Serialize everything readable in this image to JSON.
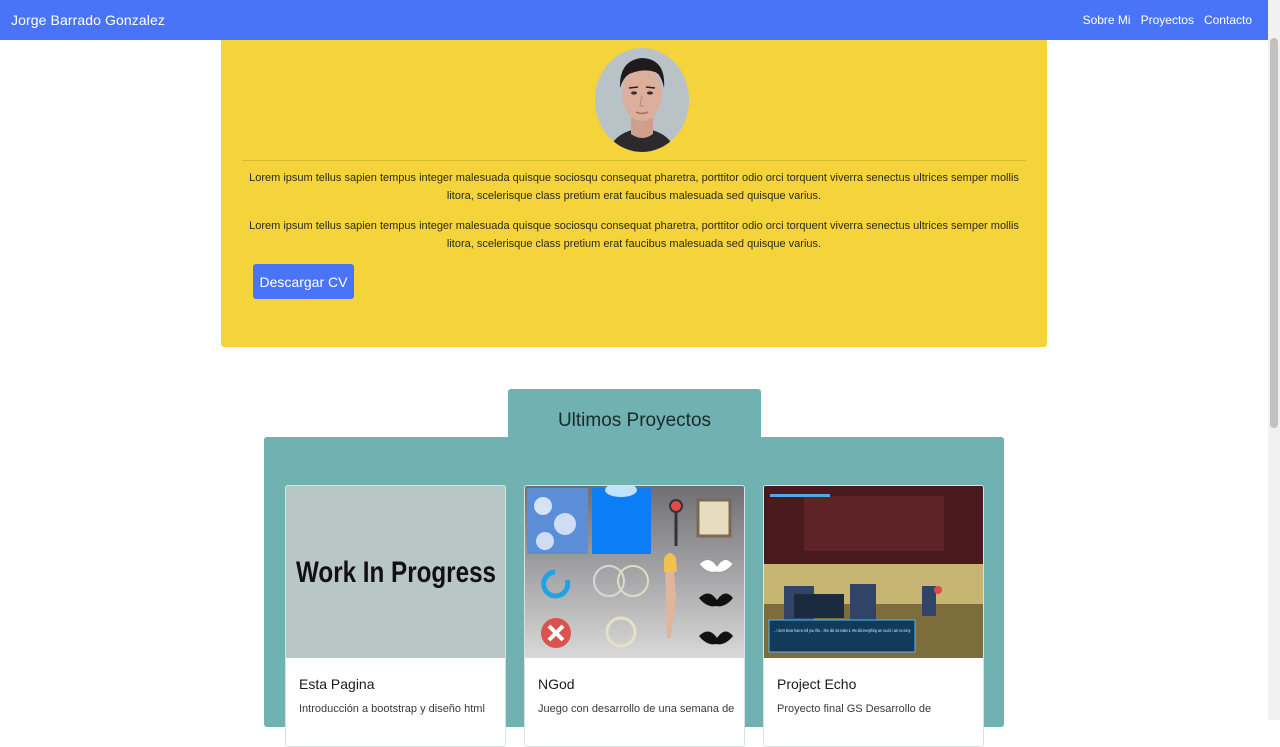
{
  "navbar": {
    "brand": "Jorge Barrado Gonzalez",
    "links": [
      "Sobre Mi",
      "Proyectos",
      "Contacto"
    ],
    "bg_color": "#4a74f7"
  },
  "hero": {
    "bg_color": "#f5d43b",
    "paragraph1": "Lorem ipsum tellus sapien tempus integer malesuada quisque sociosqu consequat pharetra, porttitor odio orci torquent viverra senectus ultrices semper mollis litora, scelerisque class pretium erat faucibus malesuada sed quisque varius.",
    "paragraph2": "Lorem ipsum tellus sapien tempus integer malesuada quisque sociosqu consequat pharetra, porttitor odio orci torquent viverra senectus ultrices semper mollis litora, scelerisque class pretium erat faucibus malesuada sed quisque varius.",
    "cv_button": "Descargar CV"
  },
  "projects": {
    "heading": "Ultimos Proyectos",
    "panel_color": "#6fb2b1",
    "cards": [
      {
        "title": "Esta Pagina",
        "text": "Introducción a bootstrap y diseño html",
        "image_text": "Work In Progress"
      },
      {
        "title": "NGod",
        "text": "Juego con desarrollo de una semana de",
        "image_icon": "game-assets-sprite-sheet"
      },
      {
        "title": "Project Echo",
        "text": "Proyecto final GS Desarrollo de",
        "image_icon": "game-screenshot",
        "dialog_text": "... I don't know how to tell you this... She did not make it. We did everything we could. I am so sorry."
      }
    ]
  }
}
